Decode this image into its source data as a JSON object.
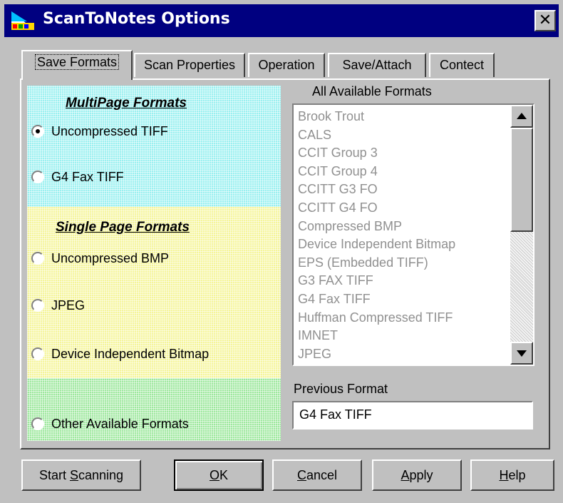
{
  "window": {
    "title": "ScanToNotes Options",
    "close_label": "✕"
  },
  "tabs": [
    {
      "label": "Save Formats",
      "active": true
    },
    {
      "label": "Scan Properties",
      "active": false
    },
    {
      "label": "Operation",
      "active": false
    },
    {
      "label": "Save/Attach",
      "active": false
    },
    {
      "label": "Contect",
      "active": false
    }
  ],
  "multipage": {
    "heading": "MultiPage Formats",
    "options": [
      {
        "label": "Uncompressed TIFF",
        "selected": true
      },
      {
        "label": "G4 Fax TIFF",
        "selected": false
      }
    ]
  },
  "singlepage": {
    "heading": "Single Page Formats",
    "options": [
      {
        "label": "Uncompressed BMP",
        "selected": false
      },
      {
        "label": "JPEG",
        "selected": false
      },
      {
        "label": "Device Independent Bitmap",
        "selected": false
      }
    ]
  },
  "other": {
    "label": "Other Available Formats",
    "selected": false
  },
  "available": {
    "label": "All Available Formats",
    "items": [
      "Brook Trout",
      "CALS",
      "CCIT Group 3",
      "CCIT Group 4",
      "CCITT G3 FO",
      "CCITT G4 FO",
      "Compressed BMP",
      "Device Independent Bitmap",
      "EPS (Embedded TIFF)",
      "G3 FAX TIFF",
      "G4 Fax TIFF",
      "Huffman Compressed TIFF",
      "IMNET",
      "JPEG"
    ]
  },
  "previous": {
    "label": "Previous Format",
    "value": "G4 Fax TIFF"
  },
  "buttons": {
    "start": {
      "prefix": "Start ",
      "accel": "S",
      "rest": "canning"
    },
    "ok": {
      "prefix": "",
      "accel": "O",
      "rest": "K"
    },
    "cancel": {
      "prefix": "",
      "accel": "C",
      "rest": "ancel"
    },
    "apply": {
      "prefix": "",
      "accel": "A",
      "rest": "pply"
    },
    "help": {
      "prefix": "",
      "accel": "H",
      "rest": "elp"
    }
  },
  "colors": {
    "titlebar": "#000080",
    "multipage_bg": "#99f0f0",
    "singlepage_bg": "#f5f59a",
    "other_bg": "#9ee89e",
    "disabled_text": "#909090"
  }
}
